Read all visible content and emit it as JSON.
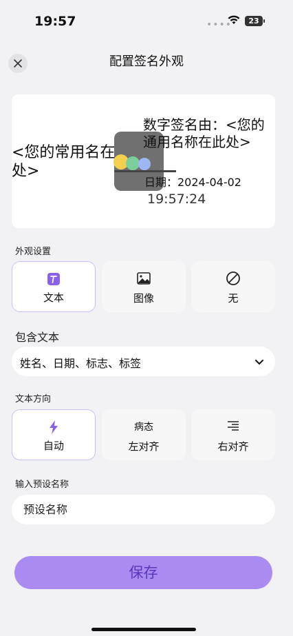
{
  "status": {
    "time": "19:57",
    "battery": "23"
  },
  "header": {
    "title": "配置签名外观"
  },
  "preview": {
    "name_text": "<您的常用名在此处>",
    "signed_by": "数字签名由：<您的通用名称在此处>",
    "date_text": "日期：2024-04-02",
    "time_text": "19:57:24"
  },
  "appearance": {
    "label": "外观设置",
    "options": [
      {
        "label": "文本",
        "icon": "text-icon",
        "selected": true
      },
      {
        "label": "图像",
        "icon": "image-icon",
        "selected": false
      },
      {
        "label": "无",
        "icon": "none-icon",
        "selected": false
      }
    ]
  },
  "include": {
    "label": "包含文本",
    "value": "姓名、日期、标志、标签"
  },
  "direction": {
    "label": "文本方向",
    "options": [
      {
        "label": "自动",
        "icon": "auto-icon",
        "selected": true
      },
      {
        "label": "左对齐",
        "icon_text": "病态",
        "selected": false
      },
      {
        "label": "右对齐",
        "icon": "align-right-icon",
        "selected": false
      }
    ]
  },
  "preset": {
    "label": "输入预设名称",
    "placeholder": "预设名称"
  },
  "save_label": "保存",
  "colors": {
    "accent": "#a98bf1",
    "accent_text": "#5a37b8",
    "selected_border": "#c9c2f2"
  }
}
